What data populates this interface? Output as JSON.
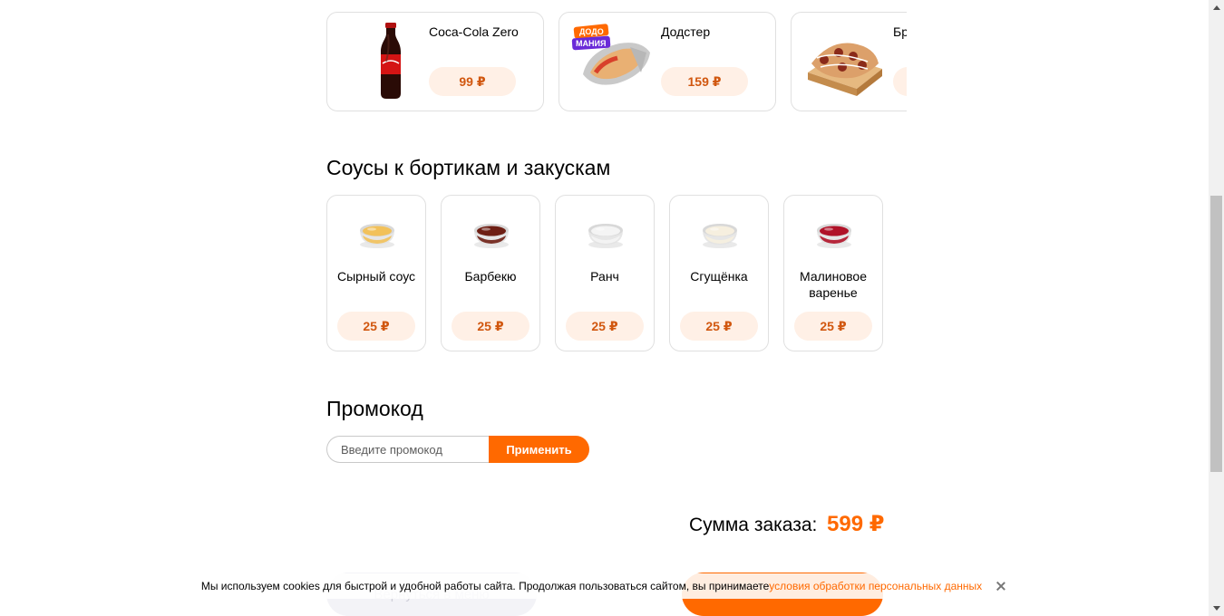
{
  "products": [
    {
      "name": "Coca-Cola Zero",
      "price": "99 ₽"
    },
    {
      "name": "Додстер",
      "price": "159 ₽",
      "badge_line1": "ДОДО",
      "badge_line2": "МАНИЯ"
    },
    {
      "name": "Брускетты штрудель",
      "price": ""
    }
  ],
  "sauces": {
    "title": "Соусы к бортикам и закускам",
    "items": [
      {
        "name": "Сырный соус",
        "price": "25 ₽",
        "color": "#f2c15a"
      },
      {
        "name": "Барбекю",
        "price": "25 ₽",
        "color": "#6e1f14"
      },
      {
        "name": "Ранч",
        "price": "25 ₽",
        "color": "#f4f4f4"
      },
      {
        "name": "Сгущёнка",
        "price": "25 ₽",
        "color": "#f6efdf"
      },
      {
        "name": "Малиновое варенье",
        "price": "25 ₽",
        "color": "#b01228"
      }
    ]
  },
  "promo": {
    "title": "Промокод",
    "placeholder": "Введите промокод",
    "apply_label": "Применить"
  },
  "order": {
    "total_label": "Сумма заказа:",
    "total_value": "599 ₽"
  },
  "footer_buttons": {
    "back_label": "Вернуться в меню"
  },
  "cookie": {
    "text": "Мы используем cookies для быстрой и удобной работы сайта. Продолжая пользоваться сайтом, вы принимаете ",
    "link": "условия обработки персональных данных"
  },
  "colors": {
    "accent": "#ff6900",
    "price_bg": "#fff0e6",
    "price_text": "#d1570f"
  }
}
